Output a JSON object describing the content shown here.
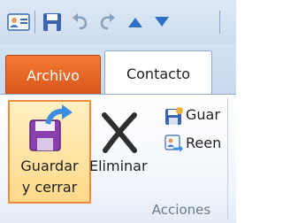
{
  "quick_access": {
    "items": [
      "contact-card-icon",
      "save-icon",
      "undo-icon",
      "redo-icon",
      "previous-item-icon",
      "next-item-icon"
    ]
  },
  "tabs": {
    "file_label": "Archivo",
    "contact_label": "Contacto"
  },
  "actions_group": {
    "save_close_label_line1": "Guardar",
    "save_close_label_line2": "y cerrar",
    "delete_label": "Eliminar",
    "save_new_label": "Guar",
    "forward_label": "Reen",
    "group_label": "Acciones"
  },
  "colors": {
    "file_tab": "#e7692a",
    "hover_border": "#f08a3c",
    "hover_fill": "#ffe2a3",
    "accent_blue": "#2f6fc4"
  }
}
